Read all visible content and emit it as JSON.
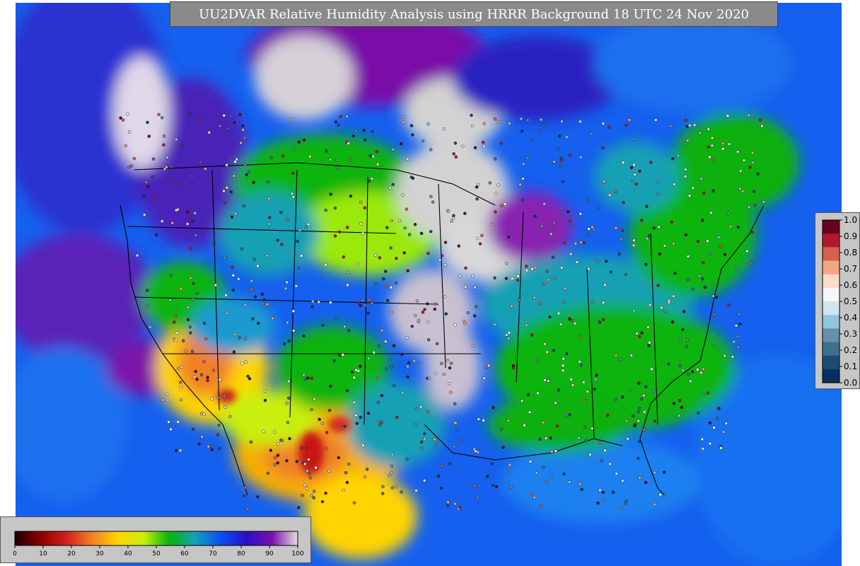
{
  "title": "UU2DVAR Relative Humidity Analysis using HRRR Background 18 UTC 24 Nov 2020",
  "rh_colorbar": {
    "ticks": [
      "0",
      "10",
      "20",
      "30",
      "40",
      "50",
      "60",
      "70",
      "80",
      "90",
      "100"
    ],
    "colors": [
      "#1a0000",
      "#8b0000",
      "#d41f1f",
      "#f08028",
      "#ffd400",
      "#c8ef10",
      "#0ab40a",
      "#14a0b4",
      "#0a50f0",
      "#2a10c8",
      "#7a10a8",
      "#e0e0e0"
    ]
  },
  "station_colorbar": {
    "ticks": [
      "1.0",
      "0.9",
      "0.8",
      "0.7",
      "0.6",
      "0.5",
      "0.4",
      "0.3",
      "0.2",
      "0.1",
      "0.0"
    ],
    "colors": [
      "#67001f",
      "#b2182b",
      "#d6604d",
      "#f4a582",
      "#fddbc7",
      "#f7f7f7",
      "#d1e5f0",
      "#92c5de",
      "#6a8fa8",
      "#3d6f8f",
      "#1c4c74",
      "#053061"
    ]
  },
  "map_legend": {
    "green": "#0ab40a",
    "cyan": "#14a0b4",
    "blue": "#0a50f0",
    "purple": "#7a10a8",
    "gray": "#d2d2d2",
    "yellow": "#ffd400",
    "orange": "#f08028",
    "red": "#d41f1f"
  }
}
